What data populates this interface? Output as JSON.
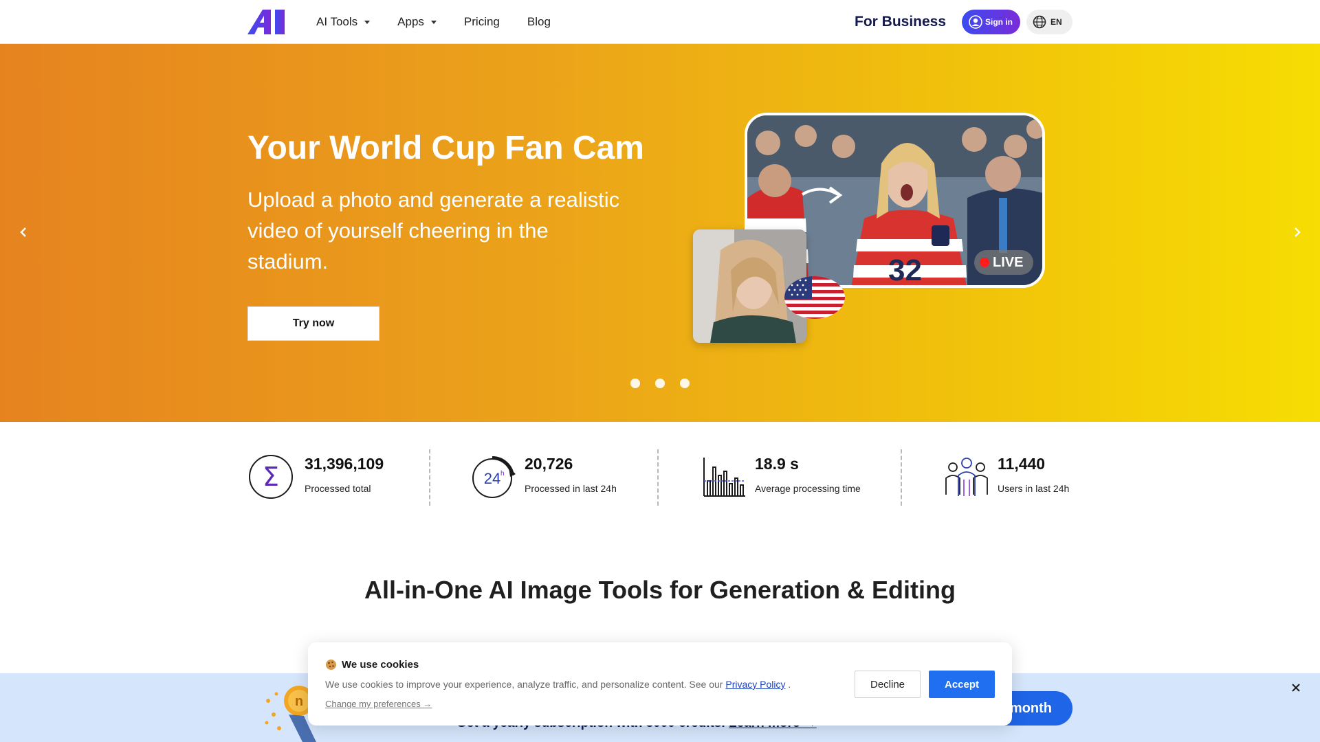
{
  "header": {
    "logo_icon": "ai-logo-icon",
    "nav": [
      {
        "label": "AI Tools",
        "has_dropdown": true
      },
      {
        "label": "Apps",
        "has_dropdown": true
      },
      {
        "label": "Pricing",
        "has_dropdown": false
      },
      {
        "label": "Blog",
        "has_dropdown": false
      }
    ],
    "for_business": "For Business",
    "sign_in": "Sign in",
    "language": "EN"
  },
  "hero": {
    "title": "Your World Cup Fan Cam",
    "subtitle": "Upload a photo and generate a realistic video of yourself cheering in the stadium.",
    "cta": "Try now",
    "live_badge": "LIVE",
    "slides_count": 3,
    "active_slide": 1
  },
  "stats": [
    {
      "value": "31,396,109",
      "label": "Processed total",
      "icon": "sigma-icon"
    },
    {
      "value": "20,726",
      "label": "Processed in last 24h",
      "icon": "clock-24h-icon"
    },
    {
      "value": "18.9 s",
      "label": "Average processing time",
      "icon": "bar-chart-icon"
    },
    {
      "value": "11,440",
      "label": "Users in last 24h",
      "icon": "users-icon"
    }
  ],
  "section_title": "All-in-One AI Image Tools for Generation & Editing",
  "promo": {
    "text": "Get a yearly subscription with 3000 credits.",
    "link": "Learn more →",
    "button": "month"
  },
  "cookie": {
    "title": "We use cookies",
    "text": "We use cookies to improve your experience, analyze traffic, and personalize content. See our",
    "policy_link": "Privacy Policy",
    "text_end": ".",
    "preferences": "Change my preferences →",
    "decline": "Decline",
    "accept": "Accept"
  },
  "colors": {
    "brand_blue": "#1f6ff0",
    "logo_gradient_start": "#3b4cf0",
    "logo_gradient_end": "#7a2bd8",
    "hero_start": "#e6831f",
    "hero_end": "#f7dd03",
    "promo_bg": "#d5e5fb"
  }
}
